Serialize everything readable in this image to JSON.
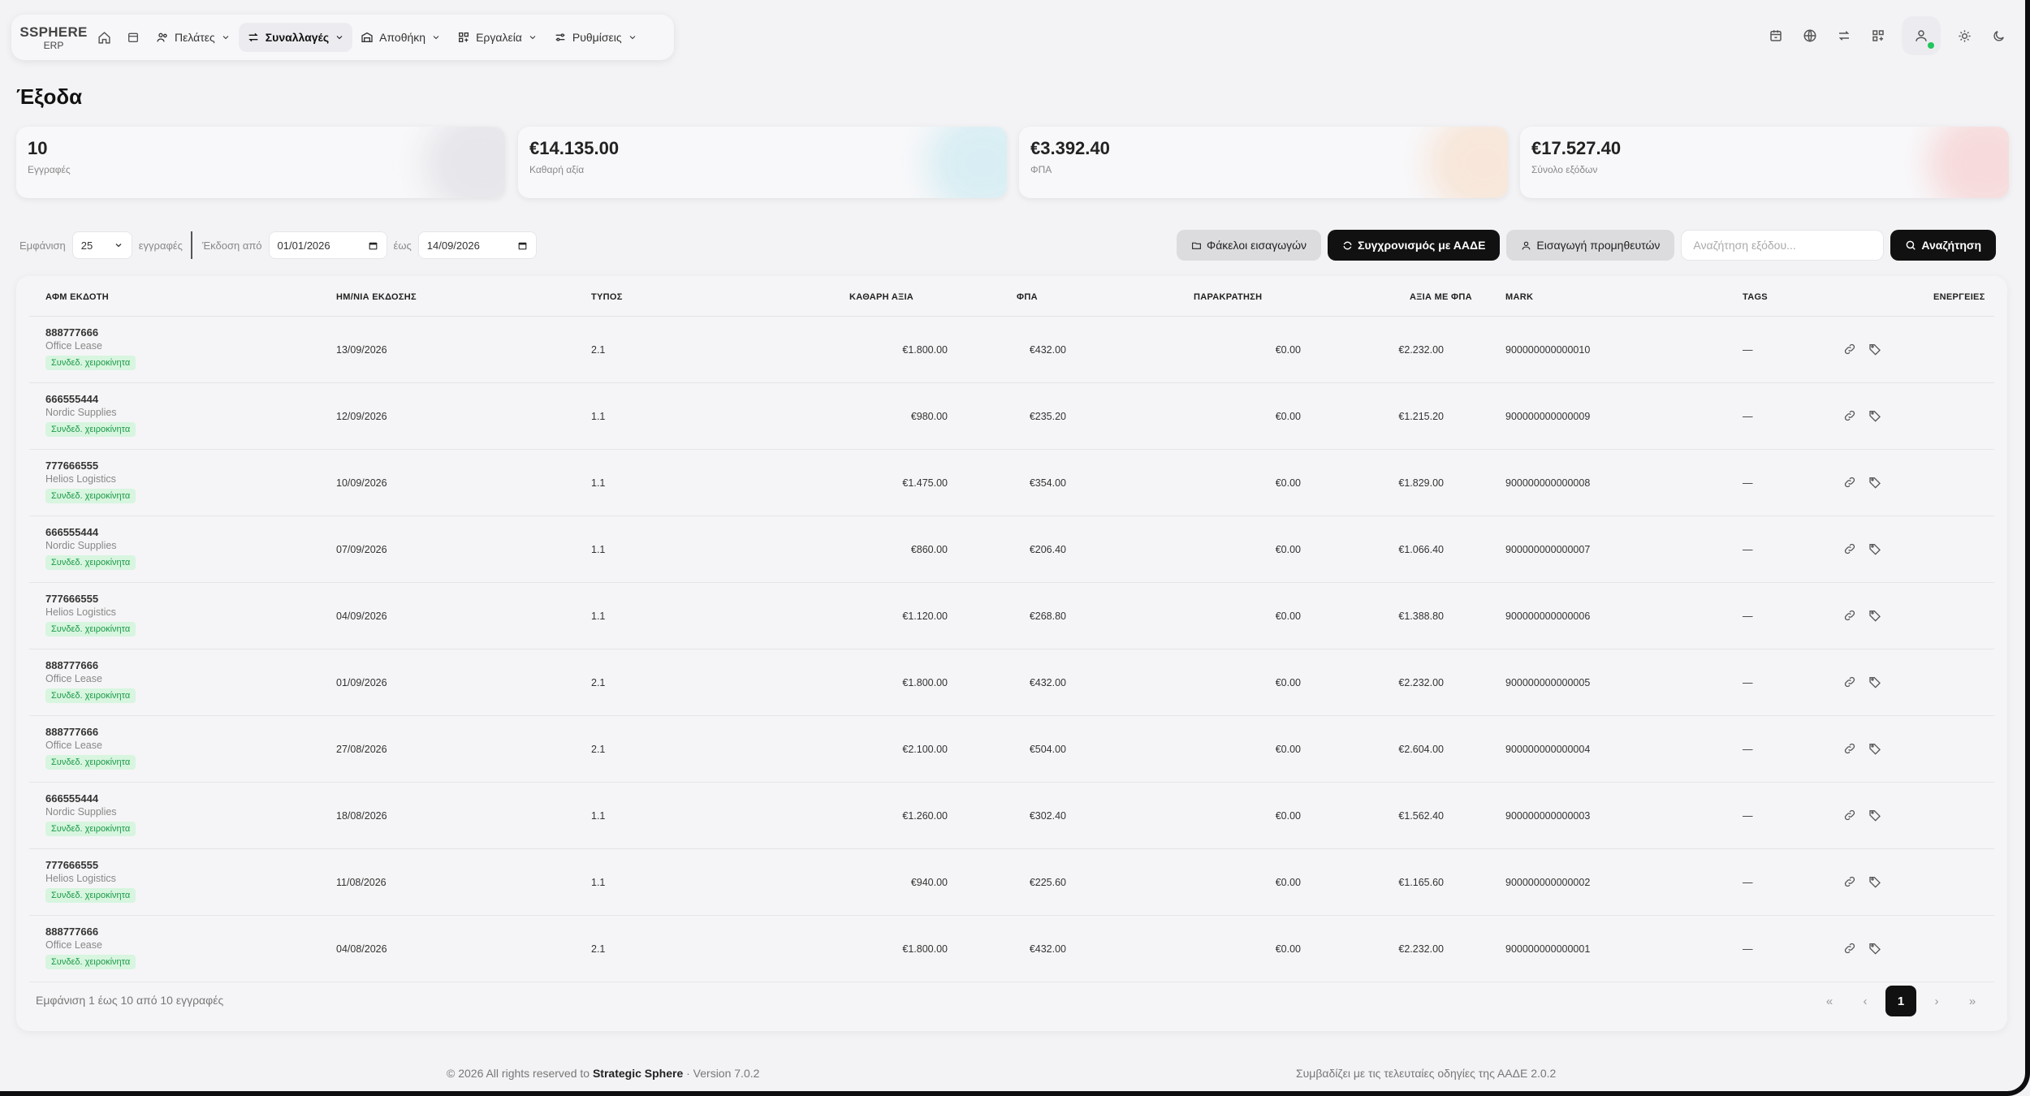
{
  "app": {
    "logo_line1": "SSPHERE",
    "logo_line2": "ERP"
  },
  "nav": {
    "items": [
      {
        "label": "Πελάτες",
        "icon": "users-icon"
      },
      {
        "label": "Συναλλαγές",
        "icon": "arrows-exchange-icon",
        "active": true
      },
      {
        "label": "Αποθήκη",
        "icon": "warehouse-icon"
      },
      {
        "label": "Εργαλεία",
        "icon": "tools-icon"
      },
      {
        "label": "Ρυθμίσεις",
        "icon": "sliders-icon"
      }
    ]
  },
  "page": {
    "title": "Έξοδα"
  },
  "stats": [
    {
      "value": "10",
      "label": "Εγγραφές",
      "color": "#d8d8de"
    },
    {
      "value": "€14.135.00",
      "label": "Καθαρή αξία",
      "color": "#bfe6ee"
    },
    {
      "value": "€3.392.40",
      "label": "ΦΠΑ",
      "color": "#f7d8bf"
    },
    {
      "value": "€17.527.40",
      "label": "Σύνολο εξόδων",
      "color": "#f6c3c3"
    }
  ],
  "toolbar": {
    "show_label": "Εμφάνιση",
    "page_size": "25",
    "records_label": "εγγραφές",
    "issued_from_label": "Έκδοση από",
    "date_from": "01/01/2026",
    "to_label": "έως",
    "date_to": "14/09/2026",
    "import_folders": "Φάκελοι εισαγωγών",
    "sync_aade": "Συγχρονισμός με ΑΑΔΕ",
    "import_suppliers": "Εισαγωγή προμηθευτών",
    "search_placeholder": "Αναζήτηση εξόδου...",
    "search_button": "Αναζήτηση"
  },
  "table": {
    "headers": {
      "afm": "ΑΦΜ ΕΚΔΟΤΗ",
      "date": "ΗΜ/ΝΙΑ ΕΚΔΟΣΗΣ",
      "type": "ΤΥΠΟΣ",
      "net": "ΚΑΘΑΡΗ ΑΞΙΑ",
      "vat": "ΦΠΑ",
      "withholding": "ΠΑΡΑΚΡΑΤΗΣΗ",
      "gross": "ΑΞΙΑ ΜΕ ΦΠΑ",
      "mark": "MARK",
      "tags": "TAGS",
      "actions": "ΕΝΕΡΓΕΙΕΣ"
    },
    "rows": [
      {
        "afm": "888777666",
        "name": "Office Lease",
        "badge": "Συνδεδ. χειροκίνητα",
        "date": "13/09/2026",
        "type": "2.1",
        "net": "€1.800.00",
        "vat": "€432.00",
        "withholding": "€0.00",
        "gross": "€2.232.00",
        "mark": "900000000000010",
        "tags": "—"
      },
      {
        "afm": "666555444",
        "name": "Nordic Supplies",
        "badge": "Συνδεδ. χειροκίνητα",
        "date": "12/09/2026",
        "type": "1.1",
        "net": "€980.00",
        "vat": "€235.20",
        "withholding": "€0.00",
        "gross": "€1.215.20",
        "mark": "900000000000009",
        "tags": "—"
      },
      {
        "afm": "777666555",
        "name": "Helios Logistics",
        "badge": "Συνδεδ. χειροκίνητα",
        "date": "10/09/2026",
        "type": "1.1",
        "net": "€1.475.00",
        "vat": "€354.00",
        "withholding": "€0.00",
        "gross": "€1.829.00",
        "mark": "900000000000008",
        "tags": "—"
      },
      {
        "afm": "666555444",
        "name": "Nordic Supplies",
        "badge": "Συνδεδ. χειροκίνητα",
        "date": "07/09/2026",
        "type": "1.1",
        "net": "€860.00",
        "vat": "€206.40",
        "withholding": "€0.00",
        "gross": "€1.066.40",
        "mark": "900000000000007",
        "tags": "—"
      },
      {
        "afm": "777666555",
        "name": "Helios Logistics",
        "badge": "Συνδεδ. χειροκίνητα",
        "date": "04/09/2026",
        "type": "1.1",
        "net": "€1.120.00",
        "vat": "€268.80",
        "withholding": "€0.00",
        "gross": "€1.388.80",
        "mark": "900000000000006",
        "tags": "—"
      },
      {
        "afm": "888777666",
        "name": "Office Lease",
        "badge": "Συνδεδ. χειροκίνητα",
        "date": "01/09/2026",
        "type": "2.1",
        "net": "€1.800.00",
        "vat": "€432.00",
        "withholding": "€0.00",
        "gross": "€2.232.00",
        "mark": "900000000000005",
        "tags": "—"
      },
      {
        "afm": "888777666",
        "name": "Office Lease",
        "badge": "Συνδεδ. χειροκίνητα",
        "date": "27/08/2026",
        "type": "2.1",
        "net": "€2.100.00",
        "vat": "€504.00",
        "withholding": "€0.00",
        "gross": "€2.604.00",
        "mark": "900000000000004",
        "tags": "—"
      },
      {
        "afm": "666555444",
        "name": "Nordic Supplies",
        "badge": "Συνδεδ. χειροκίνητα",
        "date": "18/08/2026",
        "type": "1.1",
        "net": "€1.260.00",
        "vat": "€302.40",
        "withholding": "€0.00",
        "gross": "€1.562.40",
        "mark": "900000000000003",
        "tags": "—"
      },
      {
        "afm": "777666555",
        "name": "Helios Logistics",
        "badge": "Συνδεδ. χειροκίνητα",
        "date": "11/08/2026",
        "type": "1.1",
        "net": "€940.00",
        "vat": "€225.60",
        "withholding": "€0.00",
        "gross": "€1.165.60",
        "mark": "900000000000002",
        "tags": "—"
      },
      {
        "afm": "888777666",
        "name": "Office Lease",
        "badge": "Συνδεδ. χειροκίνητα",
        "date": "04/08/2026",
        "type": "2.1",
        "net": "€1.800.00",
        "vat": "€432.00",
        "withholding": "€0.00",
        "gross": "€2.232.00",
        "mark": "900000000000001",
        "tags": "—"
      }
    ]
  },
  "pagination": {
    "info": "Εμφάνιση 1 έως 10 από 10 εγγραφές",
    "first": "«",
    "prev": "‹",
    "current": "1",
    "next": "›",
    "last": "»"
  },
  "footer": {
    "copyright_prefix": "© 2026 All rights reserved to",
    "company": "Strategic Sphere",
    "version": "· Version 7.0.2",
    "compliance": "Συμβαδίζει με τις τελευταίες οδηγίες της ΑΑΔΕ 2.0.2"
  }
}
